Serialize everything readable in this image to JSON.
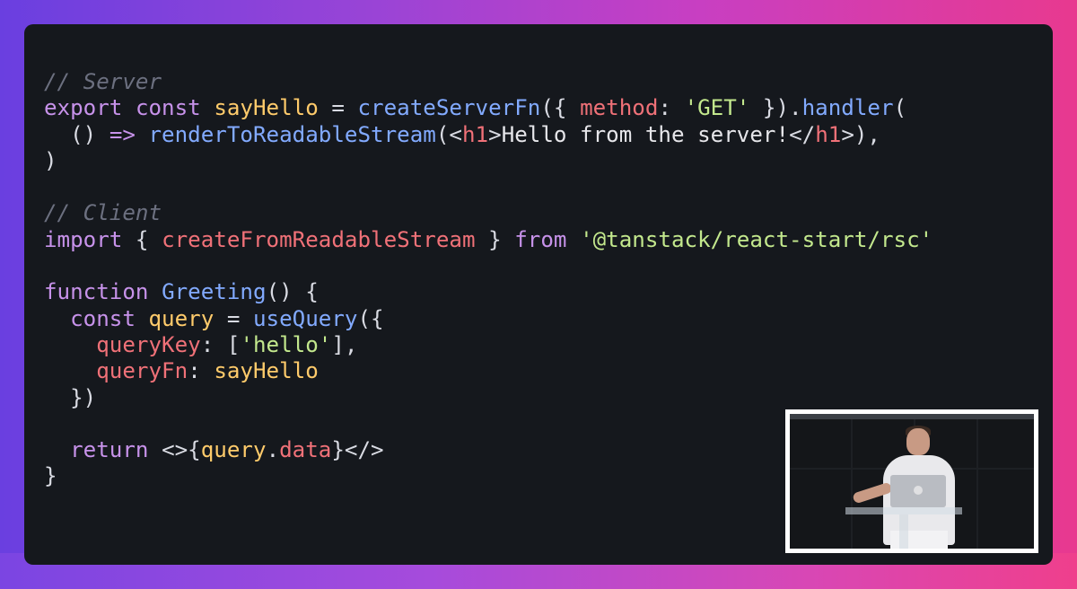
{
  "code": {
    "lines": [
      [
        {
          "t": "comment",
          "v": "// Server"
        }
      ],
      [
        {
          "t": "keyword",
          "v": "export"
        },
        {
          "t": "plain",
          "v": " "
        },
        {
          "t": "keyword",
          "v": "const"
        },
        {
          "t": "plain",
          "v": " "
        },
        {
          "t": "ident",
          "v": "sayHello"
        },
        {
          "t": "punct",
          "v": " = "
        },
        {
          "t": "fn",
          "v": "createServerFn"
        },
        {
          "t": "punct",
          "v": "({ "
        },
        {
          "t": "prop",
          "v": "method"
        },
        {
          "t": "punct",
          "v": ": "
        },
        {
          "t": "string",
          "v": "'GET'"
        },
        {
          "t": "punct",
          "v": " })."
        },
        {
          "t": "fn",
          "v": "handler"
        },
        {
          "t": "punct",
          "v": "("
        }
      ],
      [
        {
          "t": "plain",
          "v": "  "
        },
        {
          "t": "punct",
          "v": "() "
        },
        {
          "t": "keyword",
          "v": "=>"
        },
        {
          "t": "plain",
          "v": " "
        },
        {
          "t": "fn",
          "v": "renderToReadableStream"
        },
        {
          "t": "punct",
          "v": "(<"
        },
        {
          "t": "tag",
          "v": "h1"
        },
        {
          "t": "punct",
          "v": ">"
        },
        {
          "t": "plain",
          "v": "Hello from the server!"
        },
        {
          "t": "punct",
          "v": "</"
        },
        {
          "t": "tag",
          "v": "h1"
        },
        {
          "t": "punct",
          "v": ">),"
        }
      ],
      [
        {
          "t": "punct",
          "v": ")"
        }
      ],
      [],
      [
        {
          "t": "comment",
          "v": "// Client"
        }
      ],
      [
        {
          "t": "keyword",
          "v": "import"
        },
        {
          "t": "punct",
          "v": " { "
        },
        {
          "t": "prop",
          "v": "createFromReadableStream"
        },
        {
          "t": "punct",
          "v": " } "
        },
        {
          "t": "keyword",
          "v": "from"
        },
        {
          "t": "plain",
          "v": " "
        },
        {
          "t": "string",
          "v": "'@tanstack/react-start/rsc'"
        }
      ],
      [],
      [
        {
          "t": "keyword",
          "v": "function"
        },
        {
          "t": "plain",
          "v": " "
        },
        {
          "t": "fn",
          "v": "Greeting"
        },
        {
          "t": "punct",
          "v": "() {"
        }
      ],
      [
        {
          "t": "plain",
          "v": "  "
        },
        {
          "t": "keyword",
          "v": "const"
        },
        {
          "t": "plain",
          "v": " "
        },
        {
          "t": "ident",
          "v": "query"
        },
        {
          "t": "punct",
          "v": " = "
        },
        {
          "t": "fn",
          "v": "useQuery"
        },
        {
          "t": "punct",
          "v": "({"
        }
      ],
      [
        {
          "t": "plain",
          "v": "    "
        },
        {
          "t": "prop",
          "v": "queryKey"
        },
        {
          "t": "punct",
          "v": ": ["
        },
        {
          "t": "string",
          "v": "'hello'"
        },
        {
          "t": "punct",
          "v": "],"
        }
      ],
      [
        {
          "t": "plain",
          "v": "    "
        },
        {
          "t": "prop",
          "v": "queryFn"
        },
        {
          "t": "punct",
          "v": ": "
        },
        {
          "t": "ident",
          "v": "sayHello"
        }
      ],
      [
        {
          "t": "plain",
          "v": "  "
        },
        {
          "t": "punct",
          "v": "})"
        }
      ],
      [],
      [
        {
          "t": "plain",
          "v": "  "
        },
        {
          "t": "keyword",
          "v": "return"
        },
        {
          "t": "plain",
          "v": " "
        },
        {
          "t": "punct",
          "v": "<>{"
        },
        {
          "t": "ident",
          "v": "query"
        },
        {
          "t": "punct",
          "v": "."
        },
        {
          "t": "prop",
          "v": "data"
        },
        {
          "t": "punct",
          "v": "}</>"
        }
      ],
      [
        {
          "t": "punct",
          "v": "}"
        }
      ]
    ]
  },
  "video": {
    "subject": "presenter-at-podium"
  },
  "colors": {
    "background_gradient": [
      "#6a3fe0",
      "#9a44d6",
      "#c83fc2",
      "#e8398f"
    ],
    "panel": "#15181d",
    "comment": "#6c7080",
    "keyword": "#c792ea",
    "function": "#82aaff",
    "identifier": "#ffcb6b",
    "property": "#f07178",
    "string": "#c3e88d"
  }
}
